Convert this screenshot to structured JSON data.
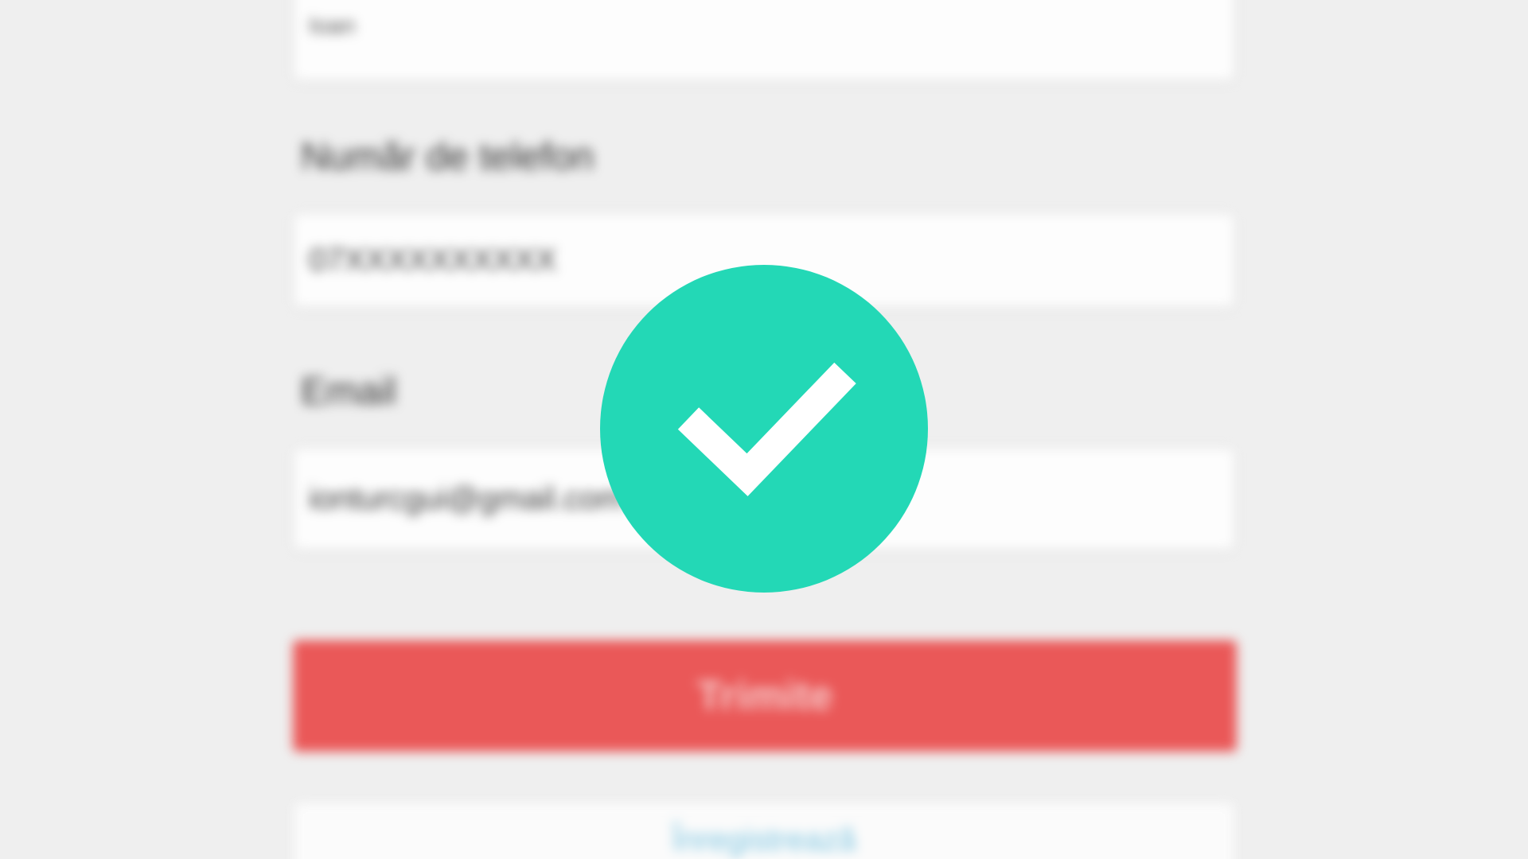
{
  "form": {
    "top_field_value": "Ioan",
    "phone_label": "Număr de telefon",
    "phone_value": "07XXXXXXXXXX",
    "email_label": "Email",
    "email_value": "ionturcgui@gmail.com",
    "submit_label": "Trimite",
    "secondary_link_label": "Înregistrează"
  },
  "overlay": {
    "icon": "check-circle-icon",
    "color": "#23d8b6",
    "checkmark_color": "#ffffff"
  },
  "colors": {
    "background": "#efefef",
    "primary_button": "#ea5858",
    "link": "#7cc4e0"
  }
}
